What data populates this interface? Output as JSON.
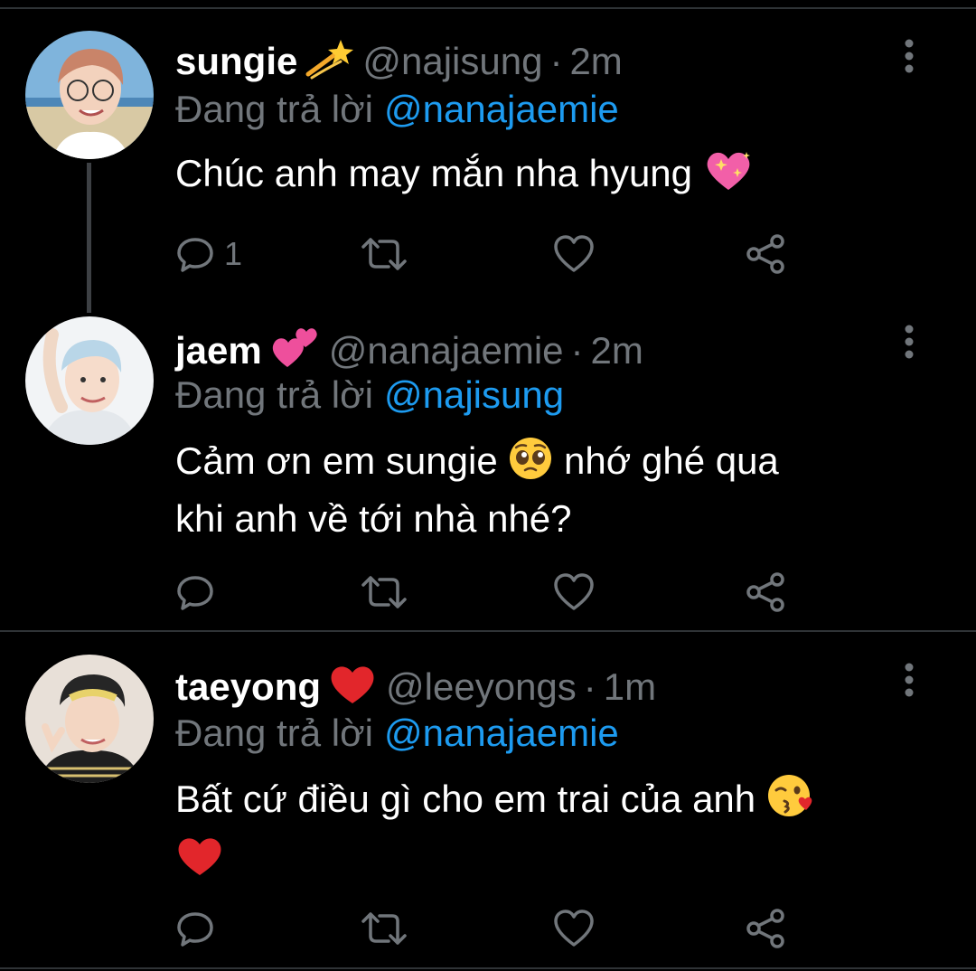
{
  "colors": {
    "background": "#000000",
    "text": "#ffffff",
    "muted": "#71767b",
    "link": "#1d9bf0",
    "divider": "#2f3336"
  },
  "tweets": [
    {
      "display_name": "sungie",
      "name_emoji": "dizzy-emoji",
      "handle": "@najisung",
      "separator": "·",
      "time": "2m",
      "replying_label": "Đang trả lời",
      "replying_to": "@nanajaemie",
      "text": "Chúc anh may mắn nha hyung",
      "text_emoji": "sparkling-heart-emoji",
      "reply_count": "1"
    },
    {
      "display_name": "jaem",
      "name_emoji": "two-hearts-emoji",
      "handle": "@nanajaemie",
      "separator": "·",
      "time": "2m",
      "replying_label": "Đang trả lời",
      "replying_to": "@najisung",
      "text_part1": "Cảm ơn em sungie",
      "text_emoji": "pleading-face-emoji",
      "text_part2": "nhớ ghé qua",
      "text_part3": "khi anh về tới nhà nhé?",
      "reply_count": ""
    },
    {
      "display_name": "taeyong",
      "name_emoji": "red-heart-emoji",
      "handle": "@leeyongs",
      "separator": "·",
      "time": "1m",
      "replying_label": "Đang trả lời",
      "replying_to": "@nanajaemie",
      "text": "Bất cứ điều gì cho em trai của anh",
      "text_emoji": "face-blowing-kiss-emoji",
      "text_emoji_2": "red-heart-emoji",
      "reply_count": ""
    }
  ]
}
